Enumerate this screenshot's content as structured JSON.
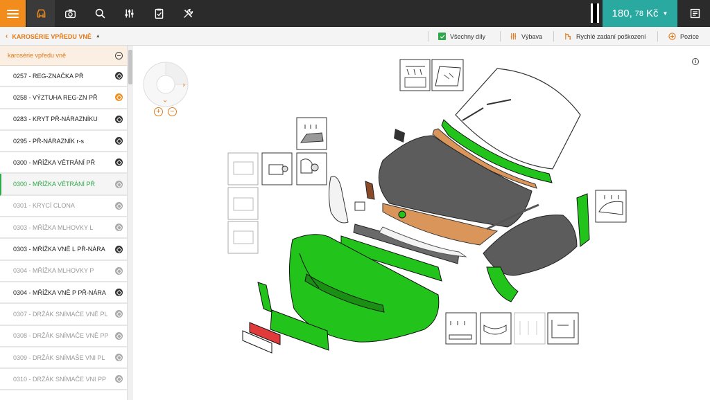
{
  "toolbar": {
    "icons": [
      "menu-icon",
      "car-icon",
      "camera-icon",
      "search-icon",
      "sliders-icon",
      "clipboard-check-icon",
      "tools-icon"
    ],
    "price": {
      "main": "180,",
      "fraction": "78",
      "currency": "Kč"
    }
  },
  "breadcrumb": {
    "label": "KAROSÉRIE VPŘEDU VNĚ"
  },
  "actions": {
    "all_parts": "Všechny díly",
    "equipment": "Výbava",
    "quick_damage": "Rychlé zadaní poškození",
    "positions": "Pozice"
  },
  "sidebar": {
    "header": "karosérie vpředu vně",
    "items": [
      {
        "label": "0257 - REG-ZNAČKA PŘ",
        "state": "normal",
        "icon": "dark"
      },
      {
        "label": "0258 - VÝZTUHA REG-ZN PŘ",
        "state": "normal",
        "icon": "orange"
      },
      {
        "label": "0283 - KRYT PŘ-NÁRAZNÍKU",
        "state": "normal",
        "icon": "dark"
      },
      {
        "label": "0295 - PŘ-NÁRAZNÍK r-s",
        "state": "normal",
        "icon": "dark"
      },
      {
        "label": "0300 - MŘÍŽKA VĚTRÁNÍ PŘ",
        "state": "normal",
        "icon": "dark"
      },
      {
        "label": "0300 - MŘÍŽKA VĚTRÁNÍ PŘ",
        "state": "selected",
        "icon": "grey"
      },
      {
        "label": "0301 - KRYCÍ CLONA",
        "state": "dim",
        "icon": "grey"
      },
      {
        "label": "0303 - MŘÍŽKA MLHOVKY L",
        "state": "dim",
        "icon": "grey"
      },
      {
        "label": "0303 - MŘÍŽKA VNĚ L PŘ-NÁRA",
        "state": "normal",
        "icon": "dark"
      },
      {
        "label": "0304 - MŘÍŽKA MLHOVKY P",
        "state": "dim",
        "icon": "grey"
      },
      {
        "label": "0304 - MŘÍŽKA VNĚ P PŘ-NÁRA",
        "state": "normal",
        "icon": "dark"
      },
      {
        "label": "0307 - DRŽÁK SNÍMAČE VNĚ PL",
        "state": "dim",
        "icon": "grey"
      },
      {
        "label": "0308 - DRŽÁK SNÍMAČE VNĚ PP",
        "state": "dim",
        "icon": "grey"
      },
      {
        "label": "0309 - DRŽÁK SNÍMAŠE VNI PL",
        "state": "dim",
        "icon": "grey"
      },
      {
        "label": "0310 - DRŽÁK SNÍMAČE VNI PP",
        "state": "dim",
        "icon": "grey"
      }
    ]
  },
  "colors": {
    "accent": "#f28c1c",
    "teal": "#2aa9a1",
    "green": "#2ea84a",
    "part_green": "#22c41c",
    "hood": "#5c5c5c",
    "copper": "#d9955a"
  }
}
